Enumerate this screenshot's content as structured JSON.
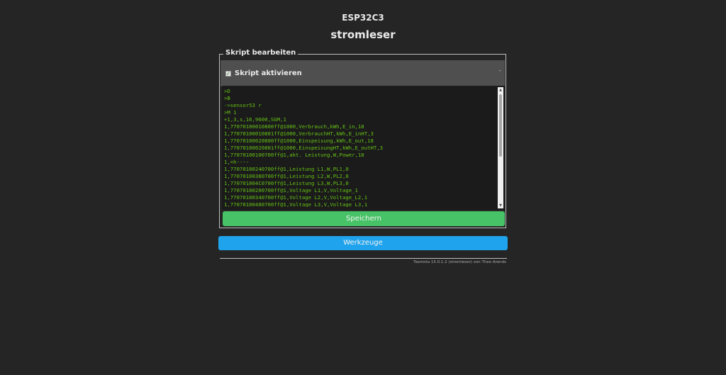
{
  "header": {
    "device_name": "ESP32C3",
    "device_title": "stromleser"
  },
  "script_panel": {
    "legend": "Skript bearbeiten",
    "enable_label": "Skript aktivieren",
    "enable_checked": true,
    "enable_check_glyph": "✓",
    "collapse_glyph": "-",
    "code_lines": [
      ">D",
      ">B",
      "->sensor53 r",
      ">M 1",
      "+1,3,s,16,9600,SGM,1",
      "1,77070100010800ff@1000,Verbrauch,kWh,E_in,18",
      "1,77070100010801ff@1000,VerbrauchHT,kWh,E_inHT,3",
      "1,77070100020800ff@1000,Einspeisung,kWh,E_out,18",
      "1,77070100020801ff@1000,EinspeisungHT,kWh,E_outHT,3",
      "1,77070100100700ff@1,akt. Leistung,W,Power,18",
      "1,=h----",
      "1,77070100240700ff@1,Leistung L1,W,PL1,0",
      "1,77070100380700ff@1,Leistung L2,W,PL2,0",
      "1,770701004C0700ff@1,Leistung L3,W,PL3,0",
      "1,77070100200700ff@1,Voltage L1,V,Voltage_1",
      "1,77070100340700ff@1,Voltage L2,V,Voltage_L2,1",
      "1,77070100480700ff@1,Voltage L3,V,Voltage_L3,1"
    ],
    "save_label": "Speichern"
  },
  "tools_label": "Werkzeuge",
  "footer": {
    "text": "Tasmota 15.0.1.2 (stromleser) von Theo Arends"
  },
  "colors": {
    "background": "#252525",
    "code_text": "#65c115",
    "save_button": "#47c266",
    "tools_button": "#1fa3ec"
  }
}
